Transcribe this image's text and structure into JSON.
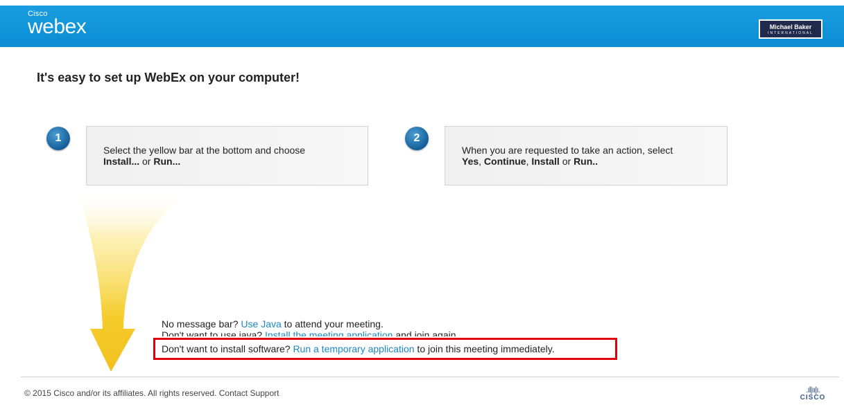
{
  "header": {
    "brand_small": "Cisco",
    "brand_large": "webex",
    "partner_name": "Michael Baker",
    "partner_sub": "INTERNATIONAL"
  },
  "page_title": "It's easy to set up WebEx on your computer!",
  "steps": [
    {
      "number": "1",
      "line1": "Select the yellow bar at the bottom and choose",
      "bold_a": "Install...",
      "mid_a": " or ",
      "bold_b": "Run..."
    },
    {
      "number": "2",
      "line1": "When you are requested to take an action, select",
      "bold_a": "Yes",
      "sep_a": ", ",
      "bold_b": "Continue",
      "sep_b": ", ",
      "bold_c": "Install",
      "mid": " or ",
      "bold_d": "Run.."
    }
  ],
  "messages": {
    "line1_pre": "No message bar? ",
    "line1_link": "Use Java",
    "line1_post": " to attend your meeting.",
    "line2_pre": "Don't want to use java? ",
    "line2_link": "Install the meeting application",
    "line2_post": " and join again.",
    "line3_pre": "Don't want to install software? ",
    "line3_link": "Run a temporary application",
    "line3_post": " to join this meeting immediately."
  },
  "footer": {
    "copyright": "© 2015 Cisco and/or its affiliates. All rights reserved.",
    "contact": "Contact Support",
    "cisco_bars": ".ıl|ıı|ı.",
    "cisco_word": "CISCO"
  },
  "colors": {
    "header_blue": "#0b8cd3",
    "link_blue": "#1b87c9",
    "step_circle": "#0e5a96",
    "highlight_red": "#e0000f",
    "arrow_yellow": "#f5cc2a"
  },
  "icons": [
    "webex-logo",
    "partner-logo",
    "yellow-arrow",
    "cisco-logo"
  ]
}
